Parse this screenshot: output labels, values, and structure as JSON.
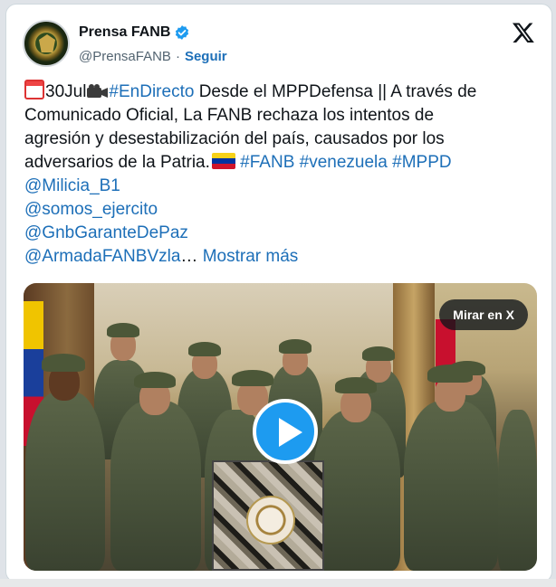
{
  "author": {
    "name": "Prensa FANB",
    "handle": "@PrensaFANB",
    "separator": "·",
    "follow_label": "Seguir"
  },
  "tweet": {
    "date": "30Jul",
    "hashtag_live": "#EnDirecto",
    "body_1": " Desde el MPPDefensa || A través de",
    "line_2": "Comunicado Oficial, La FANB rechaza los intentos de",
    "line_3": "agresión y desestabilización del país, causados por los",
    "line_4": "adversarios de la Patria.",
    "tag_fanb": "#FANB",
    "tag_venezuela": "#venezuela",
    "tag_mppd": "#MPPD",
    "mention_1": "@Milicia_B1",
    "mention_2": "@somos_ejercito",
    "mention_3": "@GnbGaranteDePaz",
    "mention_4": "@ArmadaFANBVzla",
    "ellipsis": "…",
    "show_more": "Mostrar más"
  },
  "media": {
    "watch_label": "Mirar en X"
  },
  "colors": {
    "link": "#1d6fb8",
    "play_button": "#1d9bf0",
    "verified": "#1d9bf0"
  },
  "icons": [
    "verified-badge-icon",
    "x-logo-icon",
    "calendar-icon",
    "video-camera-icon",
    "venezuela-flag-icon",
    "play-icon"
  ]
}
